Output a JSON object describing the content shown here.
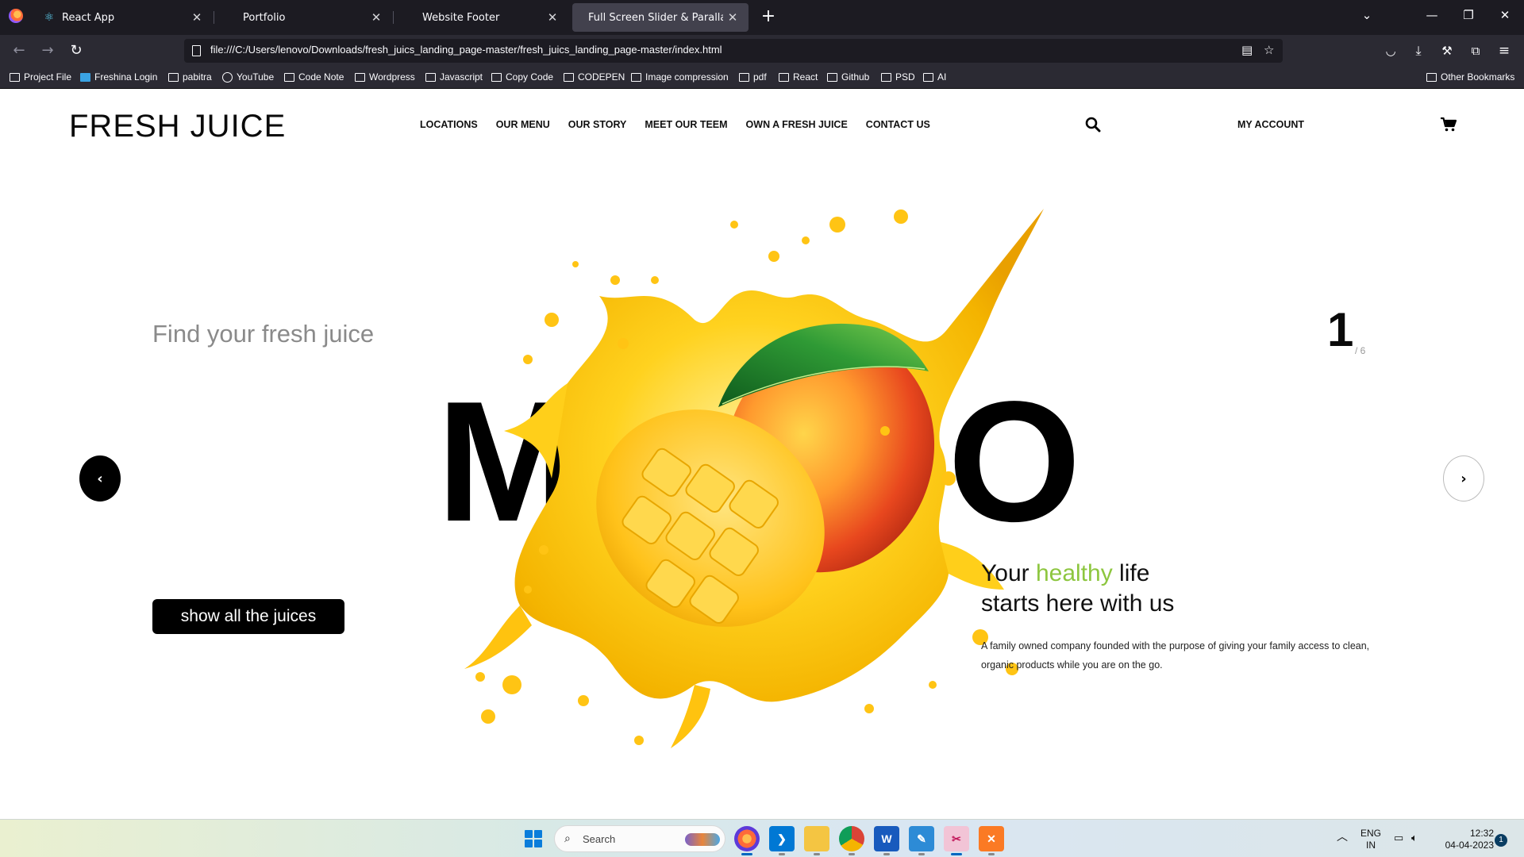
{
  "browser": {
    "tabs": [
      {
        "label": "React App",
        "icon": "react-icon"
      },
      {
        "label": "Portfolio",
        "icon": "none"
      },
      {
        "label": "Website Footer",
        "icon": "none"
      },
      {
        "label": "Full Screen Slider & Parallax",
        "icon": "none",
        "active": true
      }
    ],
    "url": "file:///C:/Users/lenovo/Downloads/fresh_juics_landing_page-master/fresh_juics_landing_page-master/index.html",
    "bookmarks": [
      "Project File",
      "Freshina Login",
      "pabitra",
      "YouTube",
      "Code Note",
      "Wordpress",
      "Javascript",
      "Copy Code",
      "CODEPEN",
      "Image compression",
      "pdf",
      "React",
      "Github",
      "PSD",
      "AI"
    ],
    "other_bookmarks": "Other Bookmarks"
  },
  "site": {
    "logo": "FRESH JUICE",
    "menu": [
      "LOCATIONS",
      "OUR MENU",
      "OUR STORY",
      "MEET OUR TEEM",
      "OWN A FRESH JUICE",
      "CONTACT US"
    ],
    "account": "MY ACCOUNT",
    "tagline": "Find your fresh juice",
    "slide_number": "1",
    "slide_total": "/ 6",
    "big_word": "MANGO",
    "cta": "show all the juices",
    "headline_part1": "Your ",
    "headline_accent": "healthy",
    "headline_part2": " life",
    "headline_line2": "starts here with us",
    "description": "A family owned company founded with the purpose of giving your family access to clean, organic products while you are on the go.",
    "accent_color": "#8dc63f"
  },
  "taskbar": {
    "search_placeholder": "Search",
    "apps": [
      "firefox-icon",
      "vscode-icon",
      "file-explorer-icon",
      "chrome-icon",
      "word-icon",
      "paint-icon",
      "snipping-tool-icon",
      "xampp-icon"
    ],
    "lang_line1": "ENG",
    "lang_line2": "IN",
    "time": "12:32",
    "date": "04-04-2023",
    "notification_count": "1"
  }
}
